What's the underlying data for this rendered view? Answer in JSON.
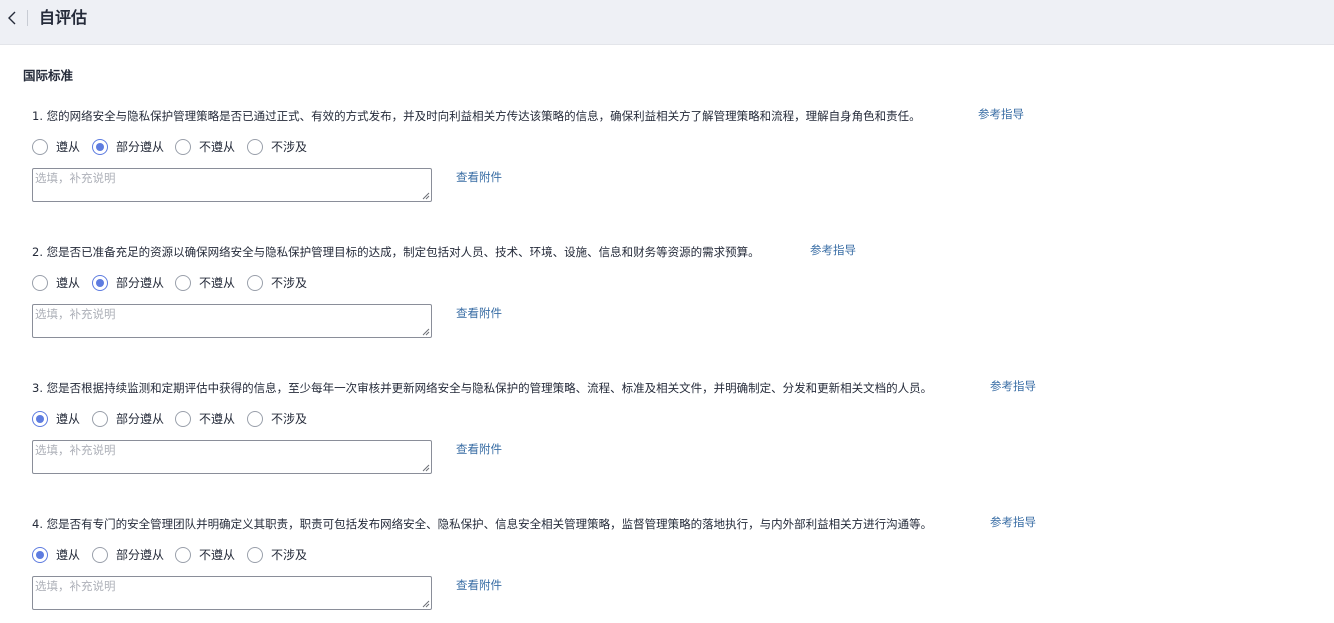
{
  "header": {
    "title": "自评估",
    "back_icon": "chevron-left-icon"
  },
  "section": {
    "title": "国际标准"
  },
  "colors": {
    "accent": "#5e7ce0",
    "link": "#3a6ea5",
    "header_bg": "#eef0f5"
  },
  "questions": [
    {
      "text": "1. 您的网络安全与隐私保护管理策略是否已通过正式、有效的方式发布，并及时向利益相关方传达该策略的信息，确保利益相关方了解管理策略和流程，理解自身角色和责任。",
      "ref_label": "参考指导",
      "options": [
        "遵从",
        "部分遵从",
        "不遵从",
        "不涉及"
      ],
      "selected": "部分遵从",
      "note_placeholder": "选填，补充说明",
      "note_value": "",
      "attach_label": "查看附件"
    },
    {
      "text": "2. 您是否已准备充足的资源以确保网络安全与隐私保护管理目标的达成，制定包括对人员、技术、环境、设施、信息和财务等资源的需求预算。",
      "ref_label": "参考指导",
      "options": [
        "遵从",
        "部分遵从",
        "不遵从",
        "不涉及"
      ],
      "selected": "部分遵从",
      "note_placeholder": "选填，补充说明",
      "note_value": "",
      "attach_label": "查看附件"
    },
    {
      "text": "3. 您是否根据持续监测和定期评估中获得的信息，至少每年一次审核并更新网络安全与隐私保护的管理策略、流程、标准及相关文件，并明确制定、分发和更新相关文档的人员。",
      "ref_label": "参考指导",
      "options": [
        "遵从",
        "部分遵从",
        "不遵从",
        "不涉及"
      ],
      "selected": "遵从",
      "note_placeholder": "选填，补充说明",
      "note_value": "",
      "attach_label": "查看附件"
    },
    {
      "text": "4. 您是否有专门的安全管理团队并明确定义其职责，职责可包括发布网络安全、隐私保护、信息安全相关管理策略，监督管理策略的落地执行，与内外部利益相关方进行沟通等。",
      "ref_label": "参考指导",
      "options": [
        "遵从",
        "部分遵从",
        "不遵从",
        "不涉及"
      ],
      "selected": "遵从",
      "note_placeholder": "选填，补充说明",
      "note_value": "",
      "attach_label": "查看附件"
    }
  ]
}
